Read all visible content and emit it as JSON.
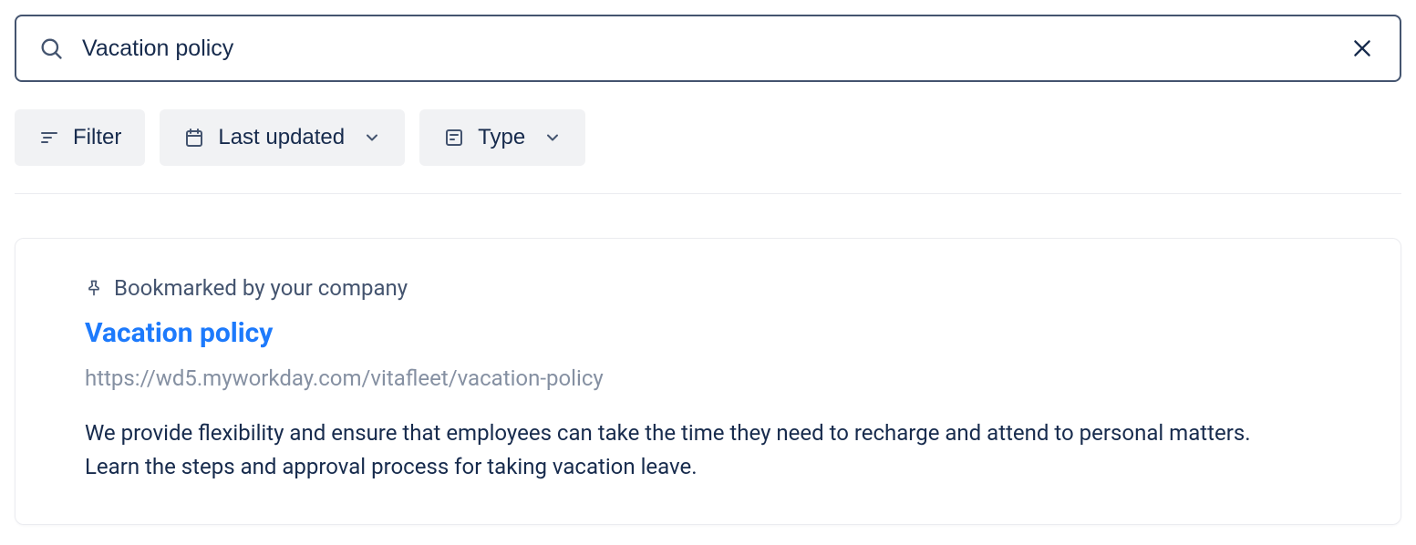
{
  "search": {
    "value": "Vacation policy"
  },
  "filters": {
    "filter_label": "Filter",
    "last_updated_label": "Last updated",
    "type_label": "Type"
  },
  "result": {
    "bookmarked_label": "Bookmarked by your company",
    "title": "Vacation policy",
    "url": "https://wd5.myworkday.com/vitafleet/vacation-policy",
    "description": "We provide flexibility and ensure that employees can take the time they need to recharge and attend to personal matters. Learn the steps and approval process for taking vacation leave."
  }
}
